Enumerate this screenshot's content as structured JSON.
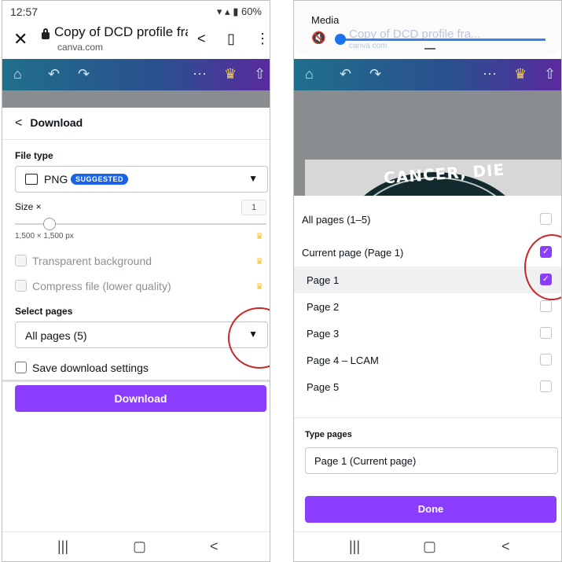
{
  "status": {
    "time": "12:57",
    "battery": "60%"
  },
  "browser": {
    "title": "Copy of DCD profile fra...",
    "url": "canva.com"
  },
  "left_panel": {
    "header": "Download",
    "file_type_label": "File type",
    "file_type_value": "PNG",
    "suggested_badge": "SUGGESTED",
    "size_label": "Size ×",
    "size_value": "1",
    "size_readout": "1,500 × 1,500 px",
    "size_slider_fraction": 0.15,
    "transparent_bg": "Transparent background",
    "compress": "Compress file (lower quality)",
    "select_pages_label": "Select pages",
    "select_pages_value": "All pages (5)",
    "save_settings": "Save download settings",
    "download_button": "Download"
  },
  "right_panel": {
    "media_title": "Media",
    "design_text": "CANCER, DIE",
    "pages": [
      {
        "label": "All pages (1–5)",
        "checked": false
      },
      {
        "label": "Current page (Page 1)",
        "checked": true
      },
      {
        "label": "Page 1",
        "checked": true
      },
      {
        "label": "Page 2",
        "checked": false
      },
      {
        "label": "Page 3",
        "checked": false
      },
      {
        "label": "Page 4 – LCAM",
        "checked": false
      },
      {
        "label": "Page 5",
        "checked": false
      }
    ],
    "type_pages_label": "Type pages",
    "type_pages_value": "Page 1 (Current page)",
    "done_button": "Done"
  },
  "colors": {
    "accent": "#8b3dff",
    "badge": "#1a63e8",
    "annotation": "#c62828"
  }
}
